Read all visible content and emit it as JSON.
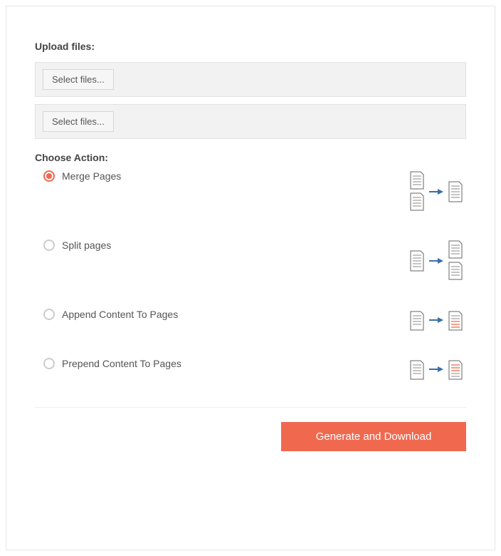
{
  "upload": {
    "label": "Upload files:",
    "select_button": "Select files..."
  },
  "choose_action": {
    "label": "Choose Action:",
    "options": [
      {
        "label": "Merge Pages",
        "selected": true
      },
      {
        "label": "Split pages",
        "selected": false
      },
      {
        "label": "Append Content To Pages",
        "selected": false
      },
      {
        "label": "Prepend Content To Pages",
        "selected": false
      }
    ]
  },
  "submit": {
    "label": "Generate and Download"
  }
}
